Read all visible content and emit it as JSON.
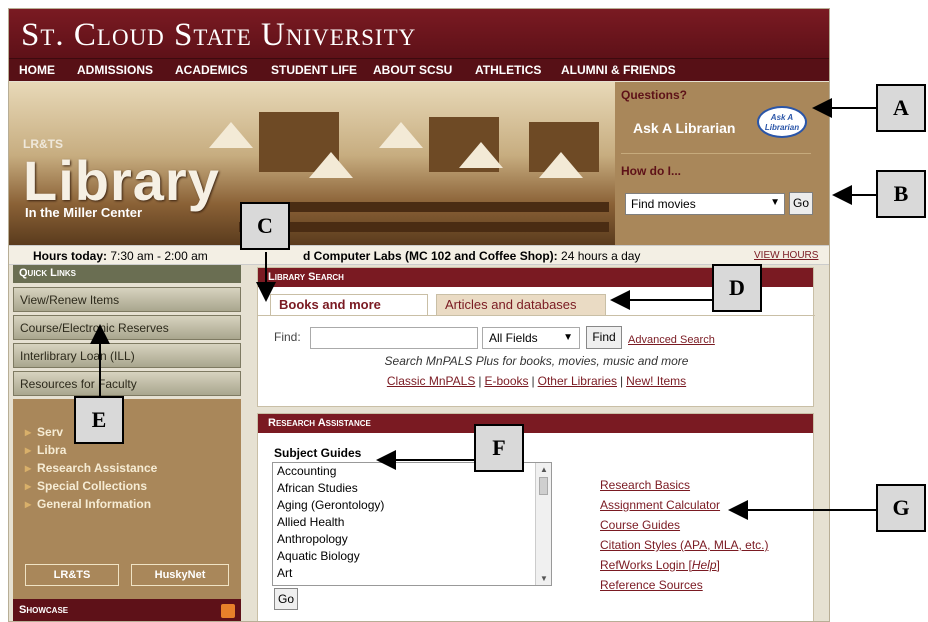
{
  "header": {
    "university": "St. Cloud State University",
    "nav": [
      "HOME",
      "ADMISSIONS",
      "ACADEMICS",
      "STUDENT LIFE",
      "ABOUT SCSU",
      "ATHLETICS",
      "ALUMNI & FRIENDS"
    ]
  },
  "banner": {
    "lrts": "LR&TS",
    "library": "Library",
    "subtitle": "In the Miller Center"
  },
  "side_box": {
    "questions": "Questions?",
    "ask": "Ask A Librarian",
    "bubble": "Ask A Librarian",
    "how_do_i": "How do I...",
    "select_value": "Find movies",
    "go": "Go"
  },
  "hours": {
    "today_label": "Hours today:",
    "today_value": "7:30 am - 2:00 am",
    "labs_label": "d Computer Labs (MC 102 and Coffee Shop):",
    "labs_value": "24 hours a day",
    "view_hours": "VIEW HOURS"
  },
  "quick_links": {
    "heading": "Quick Links",
    "items": [
      "View/Renew Items",
      "Course/Electronic Reserves",
      "Interlibrary Loan (ILL)",
      "Resources for Faculty"
    ]
  },
  "left_menu": {
    "items": [
      "Serv",
      "Libra",
      "Research Assistance",
      "Special Collections",
      "General Information"
    ],
    "button_lrts": "LR&TS",
    "button_huskynet": "HuskyNet",
    "showcase": "Showcase"
  },
  "library_search": {
    "heading": "Library Search",
    "tab_books": "Books and more",
    "tab_articles": "Articles and databases",
    "find_label": "Find:",
    "fields_value": "All Fields",
    "find_button": "Find",
    "advanced": "Advanced Search",
    "description": "Search MnPALS Plus for books, movies, music and more",
    "links": [
      "Classic MnPALS",
      "E-books",
      "Other Libraries",
      "New! Items"
    ]
  },
  "research": {
    "heading": "Research Assistance",
    "subject_guides_label": "Subject Guides",
    "subjects": [
      "Accounting",
      "African Studies",
      "Aging (Gerontology)",
      "Allied Health",
      "Anthropology",
      "Aquatic Biology",
      "Art"
    ],
    "go": "Go",
    "links": [
      "Research Basics",
      "Assignment Calculator",
      "Course Guides",
      "Citation Styles (APA, MLA, etc.)",
      "RefWorks Login [",
      "Help",
      "]",
      "Reference Sources"
    ]
  },
  "callouts": [
    "A",
    "B",
    "C",
    "D",
    "E",
    "F",
    "G"
  ],
  "colors": {
    "maroon": "#7a1a22",
    "tan": "#a9875a",
    "olive": "#6a6e52"
  }
}
